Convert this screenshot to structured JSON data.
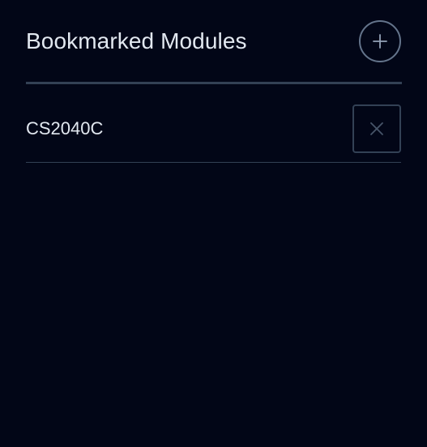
{
  "header": {
    "title": "Bookmarked Modules",
    "add_icon": "plus-icon"
  },
  "bookmarks": [
    {
      "code": "CS2040C",
      "remove_icon": "close-icon"
    }
  ],
  "colors": {
    "background": "#020617",
    "text": "#e2e8f0",
    "divider": "#334155",
    "add_button_border": "#64748b",
    "remove_button_border": "#334155",
    "remove_icon": "#475569"
  }
}
